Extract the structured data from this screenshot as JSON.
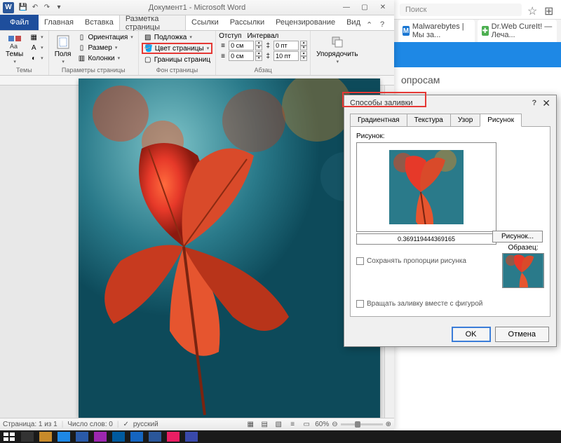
{
  "browser": {
    "search_placeholder": "Поиск",
    "tabs": [
      {
        "label": "Malwarebytes | Мы за..."
      },
      {
        "label": "Dr.Web CureIt! — Леча..."
      }
    ],
    "visible_text": "опросам"
  },
  "word": {
    "title": "Документ1 - Microsoft Word",
    "file_tab": "Файл",
    "tabs": [
      "Главная",
      "Вставка",
      "Разметка страницы",
      "Ссылки",
      "Рассылки",
      "Рецензирование",
      "Вид"
    ],
    "active_tab_index": 2,
    "ribbon": {
      "themes": {
        "label": "Темы",
        "group": "Темы"
      },
      "page_params": {
        "group": "Параметры страницы",
        "fields": "Поля",
        "orientation": "Ориентация",
        "size": "Размер",
        "columns": "Колонки"
      },
      "page_bg": {
        "group": "Фон страницы",
        "watermark": "Подложка",
        "page_color": "Цвет страницы",
        "borders": "Границы страниц"
      },
      "paragraph": {
        "group": "Абзац",
        "indent": "Отступ",
        "spacing": "Интервал",
        "left_val": "0 см",
        "right_val": "0 см",
        "before_val": "0 пт",
        "after_val": "10 пт"
      },
      "arrange": {
        "label": "Упорядочить"
      }
    },
    "status": {
      "page": "Страница: 1 из 1",
      "words": "Число слов: 0",
      "lang": "русский",
      "zoom": "60%"
    }
  },
  "dialog": {
    "title": "Способы заливки",
    "tabs": [
      "Градиентная",
      "Текстура",
      "Узор",
      "Рисунок"
    ],
    "active_tab_index": 3,
    "picture_label": "Рисунок:",
    "picture_path": "0.369119444369165",
    "picture_btn": "Рисунок...",
    "lock_aspect": "Сохранять пропорции рисунка",
    "rotate_with_shape": "Вращать заливку вместе с фигурой",
    "sample_label": "Образец:",
    "ok": "OK",
    "cancel": "Отмена"
  }
}
